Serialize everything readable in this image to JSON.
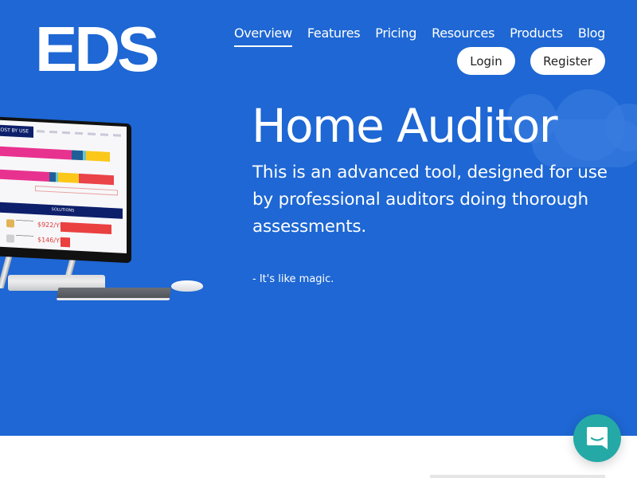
{
  "brand": {
    "logo_text": "EDS",
    "primary_color": "#1e67d4",
    "chat_color": "#25a9a6"
  },
  "nav": {
    "items": [
      {
        "label": "Overview",
        "active": true
      },
      {
        "label": "Features",
        "active": false
      },
      {
        "label": "Pricing",
        "active": false
      },
      {
        "label": "Resources",
        "active": false
      },
      {
        "label": "Products",
        "active": false
      },
      {
        "label": "Blog",
        "active": false
      }
    ],
    "login_label": "Login",
    "register_label": "Register"
  },
  "hero": {
    "title": "Home Auditor",
    "description": "This is an advanced tool, designed for use by professional auditors doing thorough assessments.",
    "tagline": "- It's like magic.",
    "illustration": {
      "screen_header": "COST BY USE",
      "solutions_header": "SOLUTIONS",
      "solution_values": [
        "$922/YR",
        "$146/YR"
      ]
    }
  },
  "chat_widget": {
    "icon": "chat-bubble-smile-icon"
  }
}
